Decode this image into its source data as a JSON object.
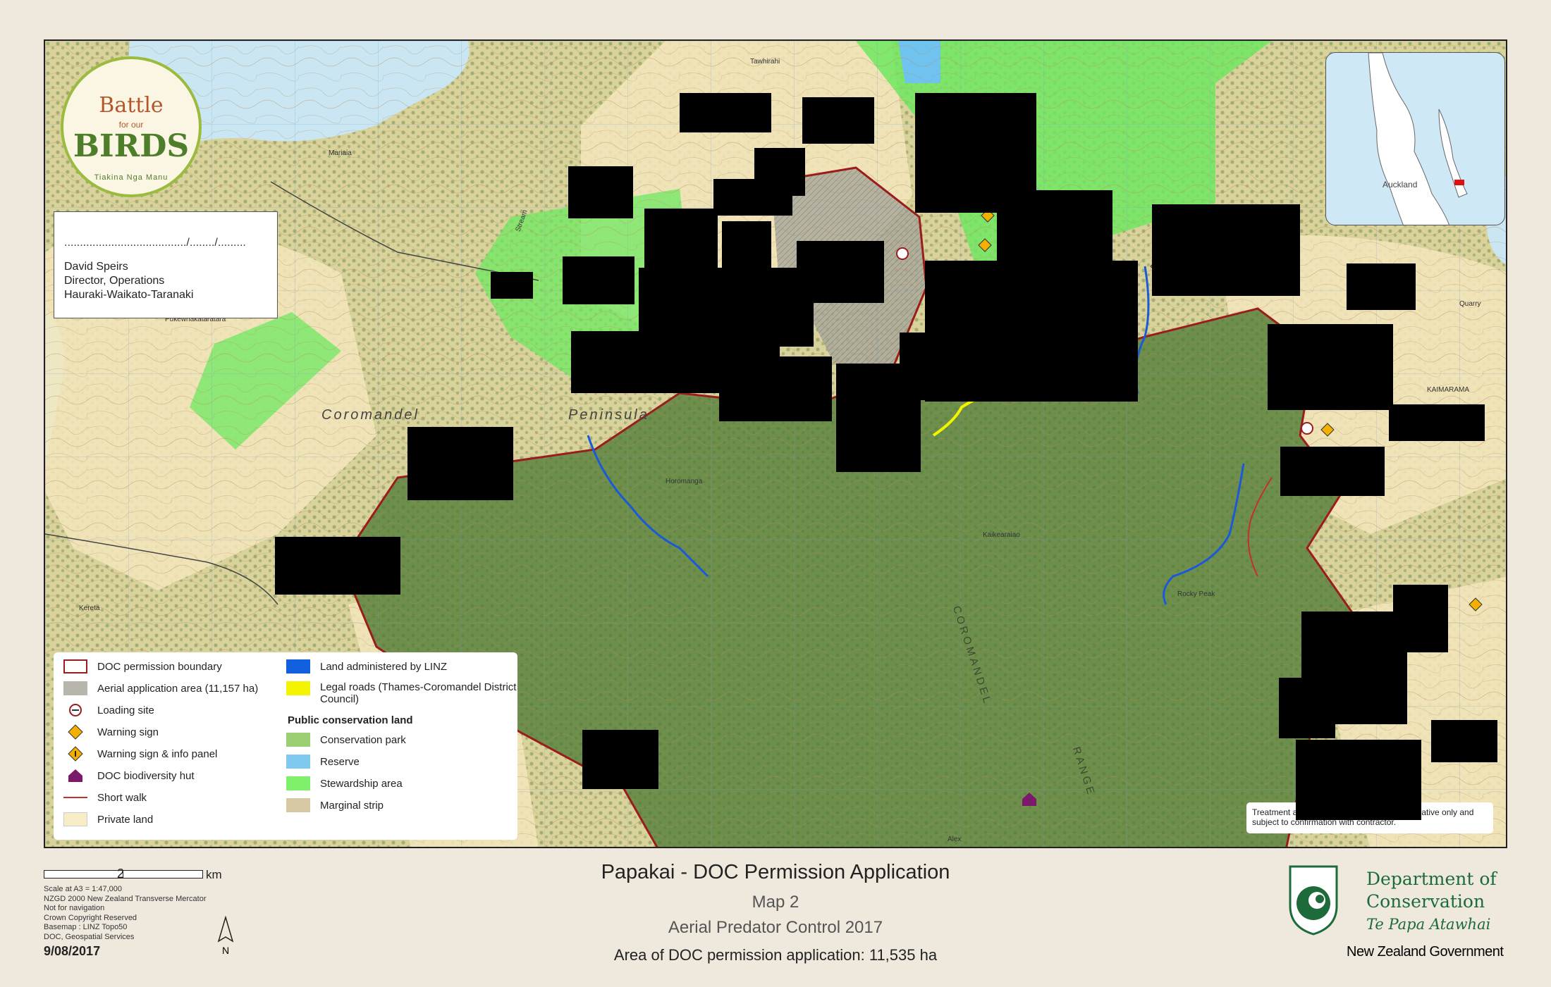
{
  "logo": {
    "line1": "Battle",
    "line2": "for our",
    "line3": "BIRDS",
    "line4": "Tiakina Nga Manu"
  },
  "signature": {
    "dots": "......................................./......../.........",
    "name": "David Speirs",
    "title": "Director, Operations",
    "region": "Hauraki-Waikato-Taranaki"
  },
  "inset": {
    "city": "Auckland"
  },
  "map_labels": {
    "region": "Coromandel",
    "peninsula": "Peninsula",
    "range1": "COROMANDEL",
    "range2": "RANGE",
    "mariaia": "Mariaia",
    "kereta": "Kereta",
    "pukewhakataratara": "Pukewhakataratara",
    "tawhiorahi": "Tawhirahi",
    "kaikearaiao": "Kaikearaiao",
    "horomanga": "Horomanga",
    "rocky_peak": "Rocky Peak",
    "stream": "Stream",
    "quarry": "Quarry",
    "kaimarama": "KAIMARAMA",
    "alex": "Alex"
  },
  "legend": {
    "col1": [
      {
        "label": "DOC permission boundary",
        "symbol": "boundary"
      },
      {
        "label": "Aerial application area (11,157 ha)",
        "symbol": "aerial"
      },
      {
        "label": "Loading site",
        "symbol": "loading"
      },
      {
        "label": "Warning sign",
        "symbol": "warning"
      },
      {
        "label": "Warning sign & info panel",
        "symbol": "warning-info"
      },
      {
        "label": "DOC biodiversity hut",
        "symbol": "hut"
      },
      {
        "label": "Short walk",
        "symbol": "walk"
      },
      {
        "label": "Private land",
        "symbol": "private"
      }
    ],
    "col2": [
      {
        "label": "Land administered by LINZ",
        "symbol": "linz"
      },
      {
        "label": "Legal roads (Thames-Coromandel District Council)",
        "symbol": "roads"
      }
    ],
    "heading": "Public conservation land",
    "col3": [
      {
        "label": "Conservation park",
        "symbol": "park"
      },
      {
        "label": "Reserve",
        "symbol": "reserve"
      },
      {
        "label": "Stewardship area",
        "symbol": "stewardship"
      },
      {
        "label": "Marginal strip",
        "symbol": "marginal"
      }
    ]
  },
  "treatment_note": "Treatment area boundary shown here is indicative only and subject to confirmation with contractor.",
  "footer": {
    "scale_number": "2",
    "scale_unit": "km",
    "notes": [
      "Scale at A3 = 1:47,000",
      "NZGD 2000 New Zealand Transverse Mercator",
      "Not for navigation",
      "Crown Copyright Reserved",
      "Basemap : LINZ Topo50",
      "DOC, Geospatial Services"
    ],
    "date": "9/08/2017",
    "north": "N"
  },
  "title": {
    "main": "Papakai - DOC Permission Application",
    "map": "Map 2",
    "subtitle": "Aerial Predator Control 2017",
    "area": "Area of DOC permission application: 11,535 ha"
  },
  "doc": {
    "name1": "Department of",
    "name2": "Conservation",
    "maori": "Te Papa Atawhai",
    "govt": "New Zealand Government"
  },
  "colors": {
    "conservation_park": "#7fa35c",
    "stewardship": "#7ef06a",
    "reserve": "#7fc8ee",
    "marginal": "#d6c8a2",
    "private": "#f6ecc6",
    "boundary": "#9b1c1c",
    "linz": "#1060e0",
    "roads": "#f4f400",
    "warning": "#f4b000",
    "hut": "#7b1a6b"
  }
}
